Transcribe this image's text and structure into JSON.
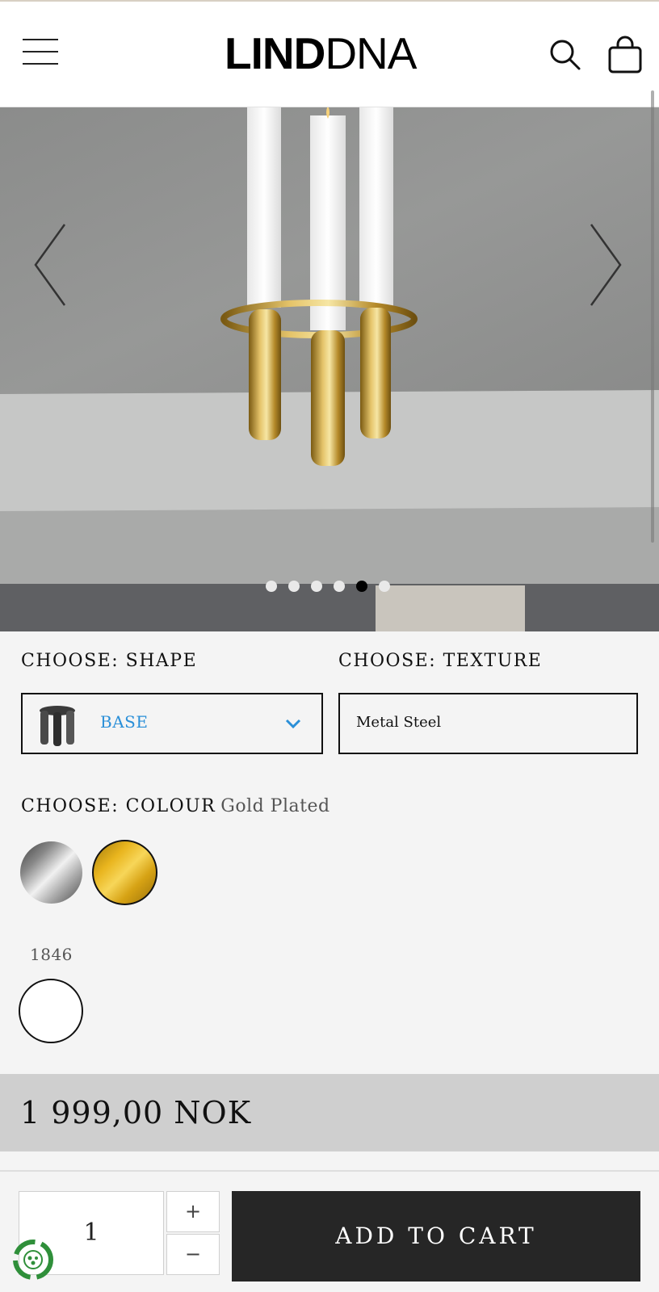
{
  "header": {
    "logo_bold": "LIND",
    "logo_thin": "DNA",
    "icons": [
      "menu-icon",
      "search-icon",
      "shopping-bag-icon"
    ]
  },
  "gallery": {
    "slide_count": 6,
    "active_slide": 5,
    "icons": [
      "chevron-left-icon",
      "chevron-right-icon"
    ]
  },
  "options": {
    "shape": {
      "label": "CHOOSE: SHAPE",
      "value": "BASE"
    },
    "texture": {
      "label": "CHOOSE: TEXTURE",
      "value": "Metal Steel"
    },
    "colour": {
      "label": "CHOOSE: COLOUR",
      "selected": "Gold Plated",
      "swatches": [
        {
          "name": "silver",
          "color": "#a8a8a8"
        },
        {
          "name": "gold",
          "color": "#e9b51e",
          "selected": true
        }
      ]
    },
    "code": {
      "label": "1846",
      "swatches": [
        {
          "name": "white",
          "color": "#ffffff",
          "selected": true
        }
      ]
    }
  },
  "price": {
    "value": "1 999,00 NOK"
  },
  "cart": {
    "quantity": "1",
    "plus": "+",
    "minus": "−",
    "add_label": "ADD TO CART"
  }
}
